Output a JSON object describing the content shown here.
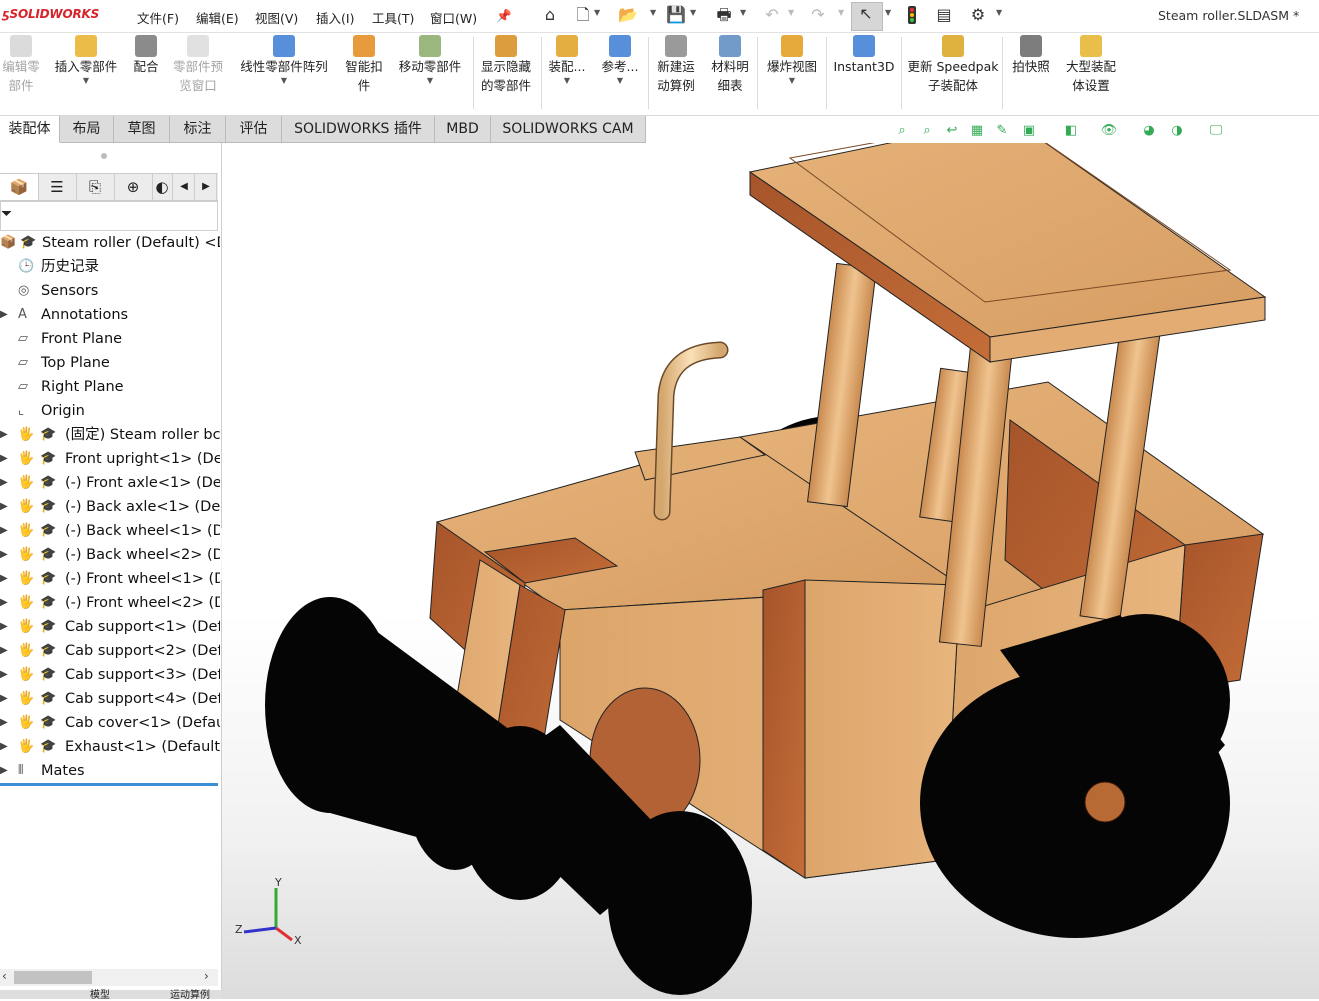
{
  "app": {
    "logo_text": "SOLIDWORKS",
    "doc_title": "Steam roller.SLDASM *"
  },
  "menu": [
    "文件(F)",
    "编辑(E)",
    "视图(V)",
    "插入(I)",
    "工具(T)",
    "窗口(W)"
  ],
  "commands": [
    {
      "label": "编辑零\n部件",
      "enabled": false,
      "icon": "edit-component-icon"
    },
    {
      "label": "插入零部件",
      "enabled": true,
      "icon": "insert-component-icon"
    },
    {
      "label": "配合",
      "enabled": true,
      "icon": "mate-icon"
    },
    {
      "label": "零部件预\n览窗口",
      "enabled": false,
      "icon": "component-preview-icon"
    },
    {
      "label": "线性零部件阵列",
      "enabled": true,
      "icon": "linear-pattern-icon"
    },
    {
      "label": "智能扣\n件",
      "enabled": true,
      "icon": "smart-fastener-icon"
    },
    {
      "label": "移动零部件",
      "enabled": true,
      "icon": "move-component-icon"
    },
    {
      "label": "显示隐藏\n的零部件",
      "enabled": true,
      "icon": "show-hidden-icon"
    },
    {
      "label": "装配...",
      "enabled": true,
      "icon": "assembly-features-icon"
    },
    {
      "label": "参考...",
      "enabled": true,
      "icon": "reference-geometry-icon"
    },
    {
      "label": "新建运\n动算例",
      "enabled": true,
      "icon": "motion-study-icon"
    },
    {
      "label": "材料明\n细表",
      "enabled": true,
      "icon": "bom-icon"
    },
    {
      "label": "爆炸视图",
      "enabled": true,
      "icon": "exploded-view-icon"
    },
    {
      "label": "Instant3D",
      "enabled": true,
      "icon": "instant3d-icon"
    },
    {
      "label": "更新 Speedpak\n子装配体",
      "enabled": true,
      "icon": "speedpak-icon"
    },
    {
      "label": "拍快照",
      "enabled": true,
      "icon": "snapshot-icon"
    },
    {
      "label": "大型装配\n体设置",
      "enabled": true,
      "icon": "large-assembly-icon"
    }
  ],
  "tabs": [
    "装配体",
    "布局",
    "草图",
    "标注",
    "评估",
    "SOLIDWORKS 插件",
    "MBD",
    "SOLIDWORKS CAM"
  ],
  "active_tab": "装配体",
  "tree": [
    {
      "label": "Steam roller (Default) <D",
      "icon": "assembly-icon",
      "expandable": false,
      "level": 0
    },
    {
      "label": "历史记录",
      "icon": "history-icon",
      "expandable": false,
      "level": 1
    },
    {
      "label": "Sensors",
      "icon": "sensors-icon",
      "expandable": false,
      "level": 1
    },
    {
      "label": "Annotations",
      "icon": "annotations-icon",
      "expandable": true,
      "level": 1
    },
    {
      "label": "Front Plane",
      "icon": "plane-icon",
      "expandable": false,
      "level": 1
    },
    {
      "label": "Top Plane",
      "icon": "plane-icon",
      "expandable": false,
      "level": 1
    },
    {
      "label": "Right Plane",
      "icon": "plane-icon",
      "expandable": false,
      "level": 1
    },
    {
      "label": "Origin",
      "icon": "origin-icon",
      "expandable": false,
      "level": 1
    },
    {
      "label": "(固定) Steam roller bc",
      "icon": "part-icon",
      "expandable": true,
      "level": 2
    },
    {
      "label": "Front upright<1> (De",
      "icon": "part-icon",
      "expandable": true,
      "level": 2
    },
    {
      "label": "(-) Front axle<1> (Def",
      "icon": "part-icon",
      "expandable": true,
      "level": 2
    },
    {
      "label": "(-) Back axle<1> (Defa",
      "icon": "part-icon",
      "expandable": true,
      "level": 2
    },
    {
      "label": "(-) Back wheel<1> (De",
      "icon": "part-icon",
      "expandable": true,
      "level": 2
    },
    {
      "label": "(-) Back wheel<2> (De",
      "icon": "part-icon",
      "expandable": true,
      "level": 2
    },
    {
      "label": "(-) Front wheel<1> (D",
      "icon": "part-icon",
      "expandable": true,
      "level": 2
    },
    {
      "label": "(-) Front wheel<2> (D",
      "icon": "part-icon",
      "expandable": true,
      "level": 2
    },
    {
      "label": "Cab support<1> (Def",
      "icon": "part-icon",
      "expandable": true,
      "level": 2
    },
    {
      "label": "Cab support<2> (Def",
      "icon": "part-icon",
      "expandable": true,
      "level": 2
    },
    {
      "label": "Cab support<3> (Def",
      "icon": "part-icon",
      "expandable": true,
      "level": 2
    },
    {
      "label": "Cab support<4> (Def",
      "icon": "part-icon",
      "expandable": true,
      "level": 2
    },
    {
      "label": "Cab cover<1> (Defau",
      "icon": "part-icon",
      "expandable": true,
      "level": 2
    },
    {
      "label": "Exhaust<1> (Default)",
      "icon": "part-icon",
      "expandable": true,
      "level": 2
    },
    {
      "label": "Mates",
      "icon": "mates-icon",
      "expandable": true,
      "level": 1
    }
  ],
  "triad": {
    "x": "X",
    "y": "Y",
    "z": "Z"
  },
  "bottom_tabs": [
    "模型",
    "运动算例"
  ],
  "colors": {
    "accent": "#3b8fd5",
    "wood": "#dba36b",
    "wheel": "#050505",
    "tab_bg": "#dcdcdc"
  }
}
